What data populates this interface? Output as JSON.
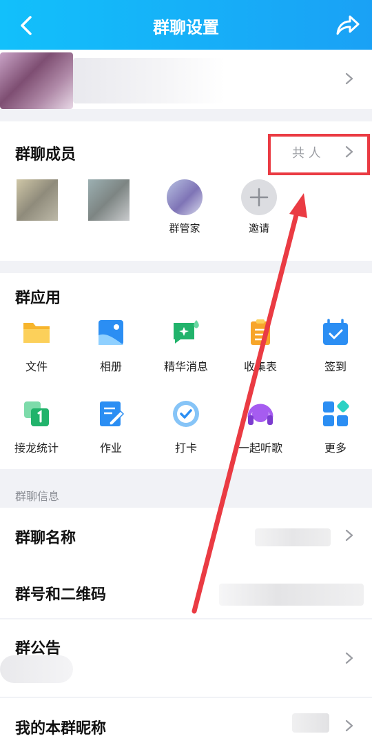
{
  "header": {
    "title": "群聊设置",
    "back_icon": "back-arrow-icon",
    "share_icon": "share-icon"
  },
  "members": {
    "title": "群聊成员",
    "count_text": "共  人",
    "items": [
      {
        "name": ""
      },
      {
        "name": ""
      },
      {
        "name": "群管家"
      },
      {
        "name": "邀请"
      }
    ]
  },
  "apps": {
    "title": "群应用",
    "items": [
      {
        "label": "文件",
        "icon": "folder-icon"
      },
      {
        "label": "相册",
        "icon": "album-icon"
      },
      {
        "label": "精华消息",
        "icon": "essence-message-icon"
      },
      {
        "label": "收集表",
        "icon": "collection-form-icon"
      },
      {
        "label": "签到",
        "icon": "check-in-calendar-icon"
      },
      {
        "label": "接龙统计",
        "icon": "relay-stats-icon"
      },
      {
        "label": "作业",
        "icon": "homework-icon"
      },
      {
        "label": "打卡",
        "icon": "punch-card-icon"
      },
      {
        "label": "一起听歌",
        "icon": "listen-together-icon"
      },
      {
        "label": "更多",
        "icon": "more-grid-icon"
      }
    ]
  },
  "info": {
    "section_label": "群聊信息",
    "name_label": "群聊名称",
    "number_label": "群号和二维码",
    "notice_label": "群公告",
    "nickname_label": "我的本群昵称"
  },
  "colors": {
    "header_start": "#12c0fb",
    "header_end": "#1aa1f5",
    "annotation": "#ea3b43"
  }
}
